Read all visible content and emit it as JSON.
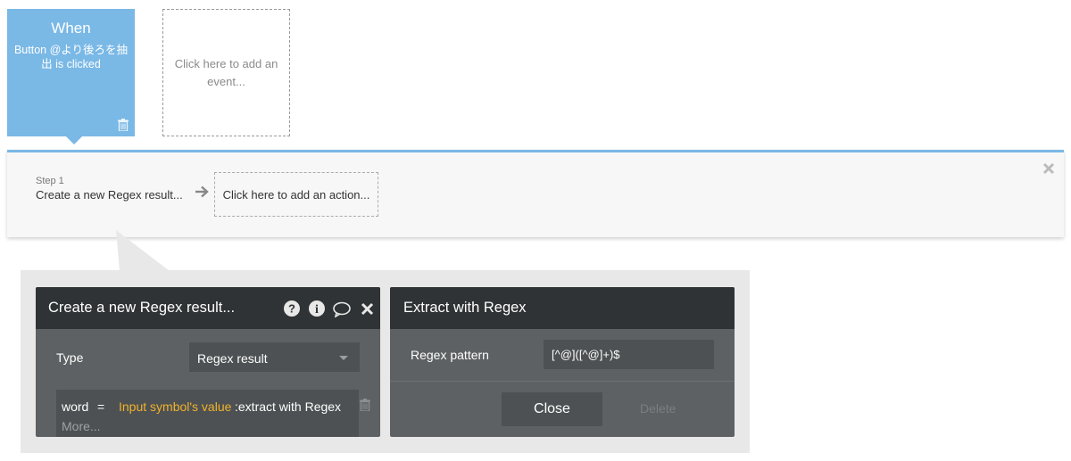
{
  "event": {
    "when_label": "When",
    "description": "Button @より後ろを抽出 is clicked",
    "add_event_text": "Click here to add an event..."
  },
  "workflow": {
    "step_label": "Step 1",
    "step_title": "Create a new Regex result...",
    "add_action_text": "Click here to add an action..."
  },
  "action_panel": {
    "title": "Create a new Regex result...",
    "type_label": "Type",
    "type_value": "Regex result",
    "field_key": "word",
    "field_equals": "=",
    "field_expression_dynamic": "Input symbol's value",
    "field_expression_rest": ":extract with Regex",
    "more_label": "More..."
  },
  "regex_panel": {
    "title": "Extract with Regex",
    "pattern_label": "Regex pattern",
    "pattern_value": "[^@]([^@]+)$",
    "close_label": "Close",
    "delete_label": "Delete"
  },
  "colors": {
    "event_blue": "#7ab8e6",
    "panel_header": "#2f3335",
    "panel_body": "#5d6163",
    "dynamic_yellow": "#f0b22c"
  },
  "icons": [
    "trash-icon",
    "arrow-right-icon",
    "close-icon",
    "help-icon",
    "info-icon",
    "comment-icon"
  ]
}
